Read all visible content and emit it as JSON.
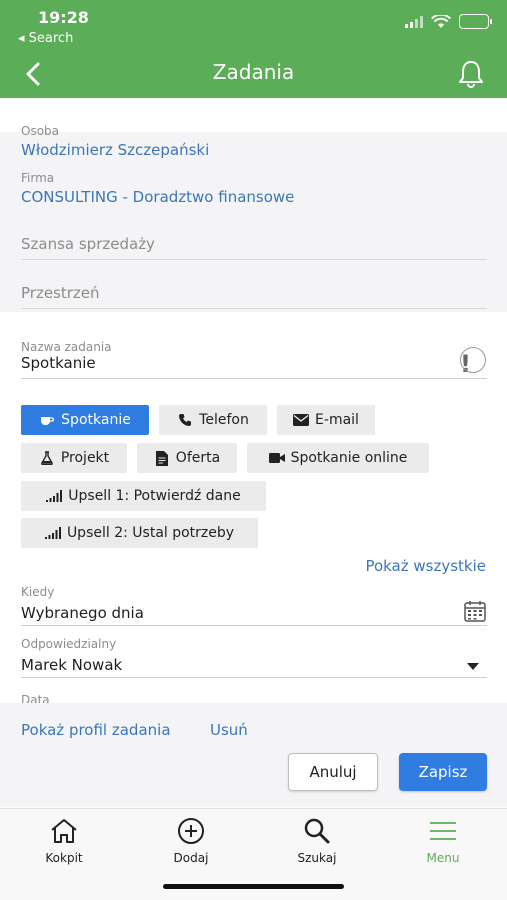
{
  "status": {
    "time": "19:28",
    "back_label": "◂ Search"
  },
  "header": {
    "title": "Zadania"
  },
  "form": {
    "osoba": {
      "label": "Osoba",
      "value": "Włodzimierz Szczepański"
    },
    "firma": {
      "label": "Firma",
      "value": "CONSULTING - Doradztwo finansowe"
    },
    "szansa_placeholder": "Szansa sprzedaży",
    "przestrzen_placeholder": "Przestrzeń",
    "task_name": {
      "label": "Nazwa zadania",
      "value": "Spotkanie",
      "priority_mark": "!"
    },
    "types": [
      {
        "label": "Spotkanie",
        "icon": "coffee-cup-icon",
        "active": true
      },
      {
        "label": "Telefon",
        "icon": "phone-icon",
        "active": false
      },
      {
        "label": "E-mail",
        "icon": "envelope-icon",
        "active": false
      },
      {
        "label": "Projekt",
        "icon": "flask-icon",
        "active": false
      },
      {
        "label": "Oferta",
        "icon": "document-icon",
        "active": false
      },
      {
        "label": "Spotkanie online",
        "icon": "video-camera-icon",
        "active": false
      },
      {
        "label": "Upsell 1: Potwierdź dane",
        "icon": "signal-bars-icon",
        "active": false
      },
      {
        "label": "Upsell 2: Ustal potrzeby",
        "icon": "signal-bars-icon",
        "active": false
      }
    ],
    "show_all": "Pokaż wszystkie",
    "kiedy": {
      "label": "Kiedy",
      "value": "Wybranego dnia"
    },
    "odpowiedzialny": {
      "label": "Odpowiedzialny",
      "value": "Marek Nowak"
    },
    "data_label": "Data"
  },
  "actions": {
    "show_profile": "Pokaż profil zadania",
    "delete": "Usuń",
    "cancel": "Anuluj",
    "save": "Zapisz"
  },
  "tabbar": [
    {
      "label": "Kokpit",
      "icon": "home-icon",
      "active": false
    },
    {
      "label": "Dodaj",
      "icon": "plus-circle-icon",
      "active": false
    },
    {
      "label": "Szukaj",
      "icon": "search-icon",
      "active": false
    },
    {
      "label": "Menu",
      "icon": "hamburger-menu-icon",
      "active": true
    }
  ],
  "colors": {
    "header": "#5cad57",
    "accent_blue": "#2f7de1",
    "link_blue": "#3c76b8",
    "active_tab": "#5cad57"
  }
}
